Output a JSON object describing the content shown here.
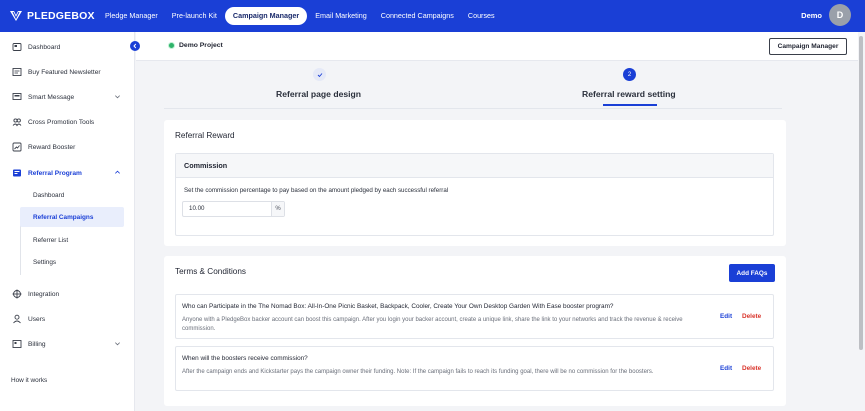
{
  "brand": {
    "name": "PLEDGEBOX",
    "color": "#1a3fd6"
  },
  "topnav": {
    "items": [
      {
        "label": "Pledge Manager",
        "active": false
      },
      {
        "label": "Pre-launch Kit",
        "active": false
      },
      {
        "label": "Campaign Manager",
        "active": true
      },
      {
        "label": "Email Marketing",
        "active": false
      },
      {
        "label": "Connected Campaigns",
        "active": false
      },
      {
        "label": "Courses",
        "active": false
      }
    ],
    "user_name": "Demo",
    "avatar_initial": "D"
  },
  "sidebar": {
    "items": [
      {
        "label": "Dashboard",
        "icon": "dashboard-icon"
      },
      {
        "label": "Buy Featured Newsletter",
        "icon": "newsletter-icon"
      },
      {
        "label": "Smart Message",
        "icon": "message-icon"
      },
      {
        "label": "Cross Promotion Tools",
        "icon": "people-icon"
      },
      {
        "label": "Reward Booster",
        "icon": "chart-icon"
      },
      {
        "label": "Referral Program",
        "icon": "referral-icon"
      },
      {
        "label": "Integration",
        "icon": "integration-icon"
      },
      {
        "label": "Users",
        "icon": "user-icon"
      },
      {
        "label": "Billing",
        "icon": "billing-icon"
      }
    ],
    "sub_items": [
      {
        "label": "Dashboard"
      },
      {
        "label": "Referral Campaigns"
      },
      {
        "label": "Referrer List"
      },
      {
        "label": "Settings"
      }
    ],
    "footer_link": "How it works"
  },
  "header": {
    "project_name": "Demo Project",
    "campaign_manager_button": "Campaign Manager"
  },
  "steps": {
    "step1_label": "Referral page design",
    "step2_number": "2",
    "step2_label": "Referral reward setting"
  },
  "referral_reward": {
    "title": "Referral Reward",
    "commission_title": "Commission",
    "commission_desc": "Set the commission percentage to pay based on the amount pledged by each successful referral",
    "commission_value": "10.00",
    "commission_unit": "%"
  },
  "terms": {
    "title": "Terms & Conditions",
    "add_button": "Add FAQs",
    "edit_label": "Edit",
    "delete_label": "Delete",
    "faqs": [
      {
        "question": "Who can Participate in the The Nomad Box: All-In-One Picnic Basket, Backpack, Cooler, Create Your Own Desktop Garden With Ease booster program?",
        "answer": "Anyone with a PledgeBox backer account can boost this campaign. After you login your backer account, create a unique link, share the link to your networks and track the revenue & receive commission."
      },
      {
        "question": "When will the boosters receive commission?",
        "answer": "After the campaign ends and Kickstarter pays the campaign owner their funding. Note: If the campaign fails to reach its funding goal, there will be no commission for the boosters."
      }
    ]
  }
}
